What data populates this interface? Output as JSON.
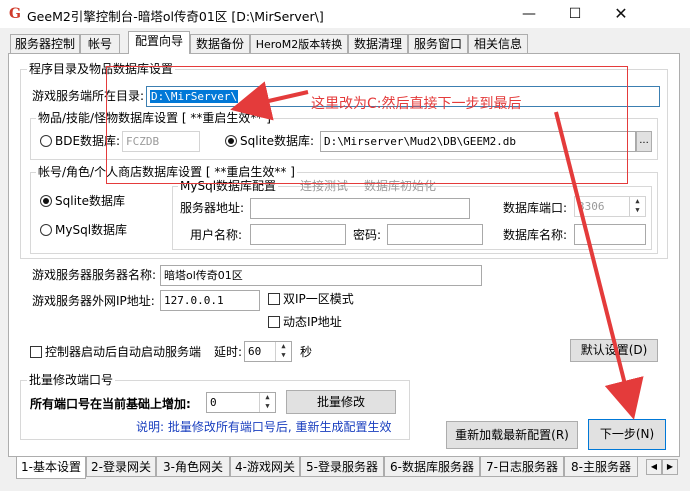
{
  "window": {
    "title": "GeeM2引擎控制台-暗塔ol传奇01区 [D:\\MirServer\\]",
    "app_icon_glyph": "G",
    "controls": [
      "minimize-icon",
      "maximize-icon",
      "close-icon"
    ]
  },
  "main_tabs": [
    "服务器控制",
    "帐号",
    "配置向导",
    "数据备份",
    "HeroM2版本转换",
    "数据清理",
    "服务窗口",
    "相关信息"
  ],
  "active_main_tab": "配置向导",
  "dir_group": {
    "title": "程序目录及物品数据库设置",
    "game_dir_label": "游戏服务端所在目录:",
    "game_dir_value": "D:\\MirServer\\",
    "db_group": {
      "title": "物品/技能/怪物数据库设置 [ **重启生效** ]",
      "bde_label": "BDE数据库:",
      "bde_value": "FCZDB",
      "sqlite_label": "Sqlite数据库:",
      "sqlite_path": "D:\\Mirserver\\Mud2\\DB\\GEEM2.db",
      "browse_label": "...",
      "selected": "sqlite"
    }
  },
  "account_group": {
    "title": "帐号/角色/个人商店数据库设置 [ **重启生效** ]",
    "sqlite_label": "Sqlite数据库",
    "mysql_label": "MySql数据库",
    "selected": "sqlite",
    "mysql_config": {
      "title": "MySql数据库配置",
      "test_link": "连接测试",
      "init_link": "数据库初始化",
      "server_addr_label": "服务器地址:",
      "port_label": "数据库端口:",
      "port_value": "3306",
      "username_label": "用户名称:",
      "password_label": "密码:",
      "dbname_label": "数据库名称:"
    }
  },
  "server": {
    "name_label": "游戏服务器服务器名称:",
    "name_value": "暗塔ol传奇01区",
    "ip_label": "游戏服务器外网IP地址:",
    "ip_value": "127.0.0.1",
    "dual_ip_label": "双IP一区模式",
    "dynamic_ip_label": "动态IP地址"
  },
  "autostart": {
    "label": "控制器启动后自动启动服务端",
    "delay_label": "延时:",
    "delay_value": "60",
    "unit": "秒"
  },
  "default_button": "默认设置(D)",
  "batch": {
    "title": "批量修改端口号",
    "increase_label": "所有端口号在当前基础上增加:",
    "increase_value": "0",
    "modify_button": "批量修改",
    "note": "说明: 批量修改所有端口号后, 重新生成配置生效"
  },
  "reload_button": "重新加载最新配置(R)",
  "next_button": "下一步(N)",
  "bottom_tabs": [
    "1-基本设置",
    "2-登录网关",
    "3-角色网关",
    "4-游戏网关",
    "5-登录服务器",
    "6-数据库服务器",
    "7-日志服务器",
    "8-主服务器"
  ],
  "annotation": {
    "text": "这里改为C:然后直接下一步到最后",
    "color": "#e43b3b"
  }
}
